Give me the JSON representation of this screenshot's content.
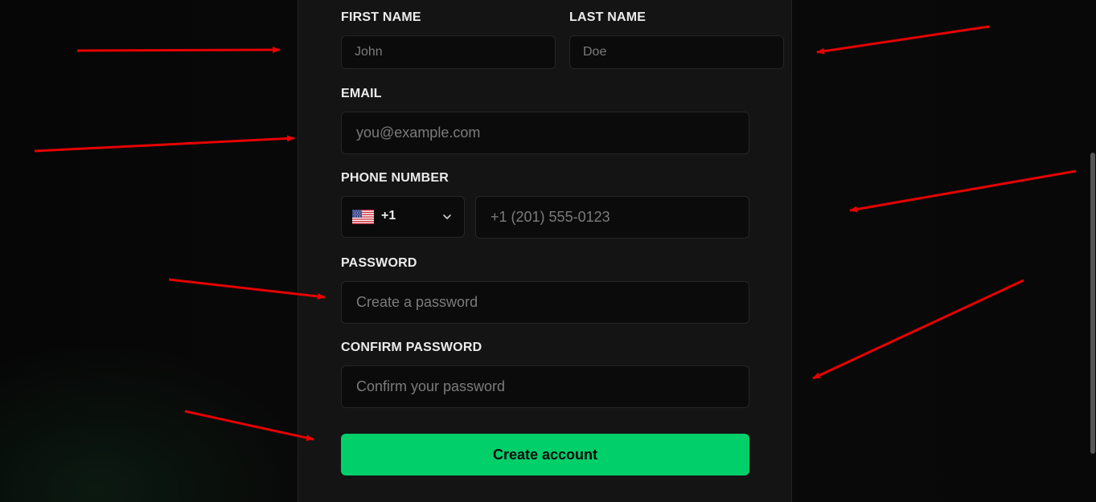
{
  "form": {
    "first_name": {
      "label": "FIRST NAME",
      "placeholder": "John"
    },
    "last_name": {
      "label": "LAST NAME",
      "placeholder": "Doe"
    },
    "email": {
      "label": "EMAIL",
      "placeholder": "you@example.com"
    },
    "phone": {
      "label": "PHONE NUMBER",
      "country_code": "+1",
      "country_flag": "us-flag-icon",
      "placeholder": "+1 (201) 555-0123"
    },
    "password": {
      "label": "PASSWORD",
      "placeholder": "Create a password"
    },
    "confirm_password": {
      "label": "CONFIRM PASSWORD",
      "placeholder": "Confirm your password"
    },
    "submit_label": "Create account"
  },
  "colors": {
    "background": "#070707",
    "panel": "#141414",
    "input_background": "#0b0b0b",
    "input_border": "#262626",
    "accent": "#00cf6a",
    "annotation_arrow": "#e60000"
  }
}
